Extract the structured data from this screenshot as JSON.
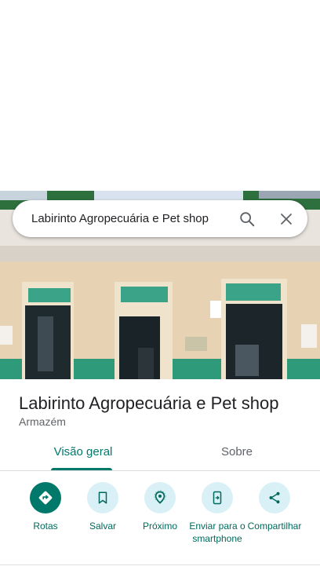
{
  "search": {
    "query": "Labirinto Agropecuária e Pet shop"
  },
  "place": {
    "title": "Labirinto Agropecuária e Pet shop",
    "category": "Armazém"
  },
  "tabs": [
    {
      "label": "Visão geral",
      "active": true
    },
    {
      "label": "Sobre",
      "active": false
    }
  ],
  "actions": [
    {
      "label": "Rotas",
      "icon": "directions-icon"
    },
    {
      "label": "Salvar",
      "icon": "bookmark-icon"
    },
    {
      "label": "Próximo",
      "icon": "nearby-icon"
    },
    {
      "label": "Enviar para o smartphone",
      "icon": "send-to-phone-icon"
    },
    {
      "label": "Compartilhar",
      "icon": "share-icon"
    }
  ],
  "colors": {
    "accent": "#00796b",
    "action_bg": "#d9f1f6",
    "text_primary": "#202124",
    "text_secondary": "#5f6368"
  }
}
